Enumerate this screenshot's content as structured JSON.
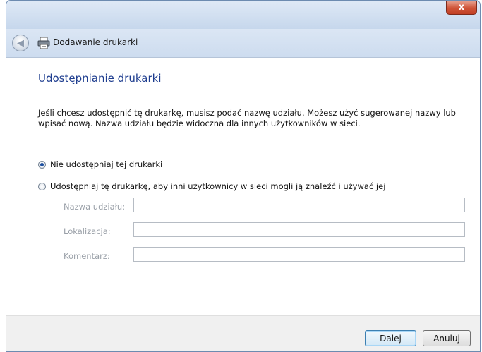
{
  "window": {
    "close_label": "x",
    "nav_title": "Dodawanie drukarki"
  },
  "content": {
    "heading": "Udostępnianie drukarki",
    "description": "Jeśli chcesz udostępnić tę drukarkę, musisz podać nazwę udziału. Możesz użyć sugerowanej nazwy lub wpisać nową. Nazwa udziału będzie widoczna dla innych użytkowników w sieci.",
    "options": [
      {
        "label": "Nie udostępniaj tej drukarki",
        "checked": true
      },
      {
        "label": "Udostępniaj tę drukarkę, aby inni użytkownicy w sieci mogli ją znaleźć i używać jej",
        "checked": false
      }
    ],
    "fields": [
      {
        "label": "Nazwa udziału:",
        "value": ""
      },
      {
        "label": "Lokalizacja:",
        "value": ""
      },
      {
        "label": "Komentarz:",
        "value": ""
      }
    ]
  },
  "footer": {
    "next_label": "Dalej",
    "cancel_label": "Anuluj"
  },
  "colors": {
    "heading": "#1e3d8f",
    "close_button": "#cf5438",
    "disabled_text": "#9aa0a8"
  },
  "icons": [
    "back-arrow-icon",
    "printer-icon",
    "close-icon"
  ]
}
